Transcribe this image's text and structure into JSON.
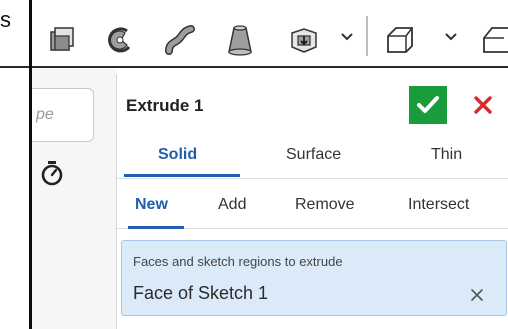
{
  "window": {
    "corner_label": "s"
  },
  "left_panel": {
    "search_placeholder": "pe"
  },
  "dialog": {
    "title": "Extrude 1",
    "tabs_type": [
      "Solid",
      "Surface",
      "Thin"
    ],
    "tabs_operation": [
      "New",
      "Add",
      "Remove",
      "Intersect"
    ],
    "selection_hint": "Faces and sketch regions to extrude",
    "selection_value": "Face of Sketch 1"
  },
  "colors": {
    "accent": "#1f5fad",
    "confirm": "#1a9b3c",
    "cancel": "#d62b2b",
    "selection_bg": "#dbeaf8"
  },
  "icons": [
    "toolbar-box-icon",
    "toolbar-revolve-icon",
    "toolbar-sweep-icon",
    "toolbar-loft-icon",
    "toolbar-thicken-icon",
    "toolbar-fillet-icon",
    "toolbar-chamfer-icon",
    "stopwatch-icon",
    "check-icon",
    "close-icon",
    "clear-selection-icon"
  ]
}
